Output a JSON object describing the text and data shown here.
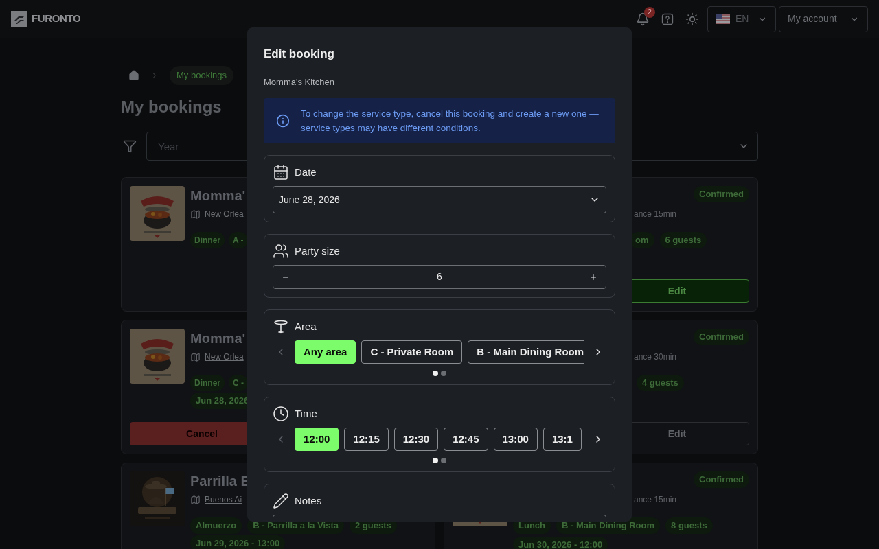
{
  "header": {
    "logo": "FURONTO",
    "notification_count": "2",
    "language": "EN",
    "account": "My account"
  },
  "breadcrumb": {
    "current": "My bookings"
  },
  "title": "My bookings",
  "filters": {
    "year": {
      "placeholder": "Year"
    }
  },
  "bookings": [
    {
      "name": "Momma'",
      "location": "New Orlea",
      "tags": [
        "Dinner",
        "A -"
      ]
    },
    {
      "status": "Confirmed",
      "details": "ance 15min",
      "tags": [
        "om",
        "6 guests"
      ],
      "button": {
        "label": "Edit",
        "kind": "primary"
      }
    },
    {
      "name": "Momma'",
      "location": "New Orlea",
      "tags": [
        "Dinner",
        "C -"
      ],
      "date": "Jun 28, 2026",
      "button": {
        "label": "Cancel",
        "kind": "danger"
      }
    },
    {
      "status": "Confirmed",
      "details": "ance 30min",
      "tags": [
        "4 guests"
      ],
      "button": {
        "label": "Edit",
        "kind": "outline"
      }
    },
    {
      "name": "Parrilla E",
      "location": "Buenos Ai",
      "tags": [
        "Almuerzo",
        "B - Parrilla a la Vista",
        "2 guests"
      ],
      "date": "Jun 29, 2026 - 13:00"
    },
    {
      "status": "Confirmed",
      "details": "ance 15min",
      "tags": [
        "Lunch",
        "B - Main Dining Room",
        "8 guests"
      ],
      "date": "Jun 30, 2026 - 12:00"
    }
  ],
  "modal": {
    "title": "Edit booking",
    "subtitle": "Momma's Kitchen",
    "info": "To change the service type, cancel this booking and create a new one — service types may have different conditions.",
    "sections": [
      {
        "kind": "date",
        "label": "Date",
        "value": "June 28, 2026"
      },
      {
        "kind": "stepper",
        "label": "Party size",
        "value": "6"
      },
      {
        "kind": "chips",
        "label": "Area",
        "prev_disabled": true,
        "options": [
          {
            "label": "Any area",
            "selected": true
          },
          {
            "label": "C - Private Room",
            "selected": false
          },
          {
            "label": "B - Main Dining Room",
            "selected": false
          }
        ],
        "pages": [
          {
            "selected": true
          },
          {
            "selected": false
          }
        ]
      },
      {
        "kind": "chips",
        "label": "Time",
        "prev_disabled": true,
        "options": [
          {
            "label": "12:00",
            "selected": true
          },
          {
            "label": "12:15",
            "selected": false
          },
          {
            "label": "12:30",
            "selected": false
          },
          {
            "label": "12:45",
            "selected": false
          },
          {
            "label": "13:00",
            "selected": false
          },
          {
            "label": "13:1",
            "selected": false
          }
        ],
        "pages": [
          {
            "selected": true
          },
          {
            "selected": false
          }
        ]
      },
      {
        "kind": "notes",
        "label": "Notes"
      }
    ]
  }
}
